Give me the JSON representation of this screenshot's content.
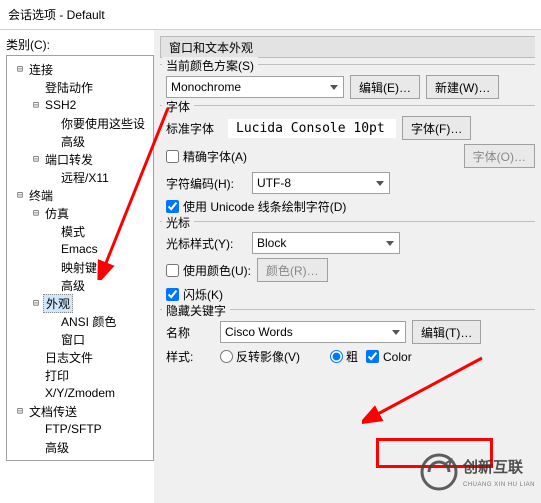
{
  "window": {
    "title": "会话选项 - Default"
  },
  "left": {
    "category_label": "类别(C):",
    "tree": [
      {
        "exp": "-",
        "label": "连接",
        "depth": 0
      },
      {
        "label": "登陆动作",
        "depth": 1
      },
      {
        "exp": "-",
        "label": "SSH2",
        "depth": 1
      },
      {
        "label": "你要使用这些设",
        "depth": 2
      },
      {
        "label": "高级",
        "depth": 2
      },
      {
        "exp": "-",
        "label": "端口转发",
        "depth": 1
      },
      {
        "label": "远程/X11",
        "depth": 2
      },
      {
        "exp": "-",
        "label": "终端",
        "depth": 0
      },
      {
        "exp": "-",
        "label": "仿真",
        "depth": 1
      },
      {
        "label": "模式",
        "depth": 2
      },
      {
        "label": "Emacs",
        "depth": 2
      },
      {
        "label": "映射键",
        "depth": 2
      },
      {
        "label": "高级",
        "depth": 2
      },
      {
        "exp": "-",
        "label": "外观",
        "depth": 1,
        "selected": true
      },
      {
        "label": "ANSI 颜色",
        "depth": 2
      },
      {
        "label": "窗口",
        "depth": 2
      },
      {
        "label": "日志文件",
        "depth": 1
      },
      {
        "label": "打印",
        "depth": 1
      },
      {
        "label": "X/Y/Zmodem",
        "depth": 1
      },
      {
        "exp": "-",
        "label": "文档传送",
        "depth": 0
      },
      {
        "label": "FTP/SFTP",
        "depth": 1
      },
      {
        "label": "高级",
        "depth": 1
      }
    ]
  },
  "right": {
    "header": "窗口和文本外观",
    "scheme": {
      "group_title": "当前颜色方案(S)",
      "select_value": "Monochrome",
      "edit_btn": "编辑(E)…",
      "new_btn": "新建(W)…"
    },
    "fonts": {
      "group_title": "字体",
      "std_label": "标准字体",
      "font_display": "Lucida Console 10pt",
      "font_btn": "字体(F)…",
      "exact_cb": "精确字体(A)",
      "font_btn2": "字体(O)…",
      "enc_label": "字符编码(H):",
      "enc_value": "UTF-8",
      "uni_cb": "使用 Unicode 线条绘制字符(D)"
    },
    "cursor": {
      "group_title": "光标",
      "style_label": "光标样式(Y):",
      "style_value": "Block",
      "usecolor_cb": "使用颜色(U):",
      "color_btn": "颜色(R)…",
      "blink_cb": "闪烁(K)"
    },
    "hidden": {
      "group_title": "隐藏关键字",
      "name_label": "名称",
      "name_value": "Cisco Words",
      "edit_btn": "编辑(T)…",
      "style_label": "样式:",
      "radio_invert": "反转影像(V)",
      "radio_bold": "粗",
      "cb_color": "Color"
    }
  },
  "watermark": {
    "main": "创新互联",
    "sub": "CHUANG XIN HU LIAN"
  }
}
